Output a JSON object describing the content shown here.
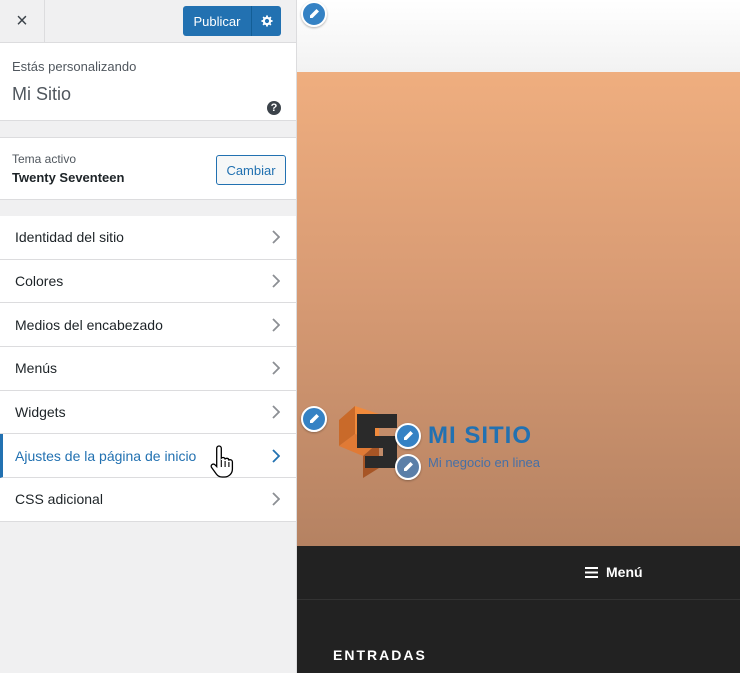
{
  "topbar": {
    "close_label": "×",
    "publish_label": "Publicar"
  },
  "customizing": {
    "label": "Estás personalizando",
    "site_name": "Mi Sitio",
    "help_label": "?"
  },
  "theme": {
    "label": "Tema activo",
    "name": "Twenty Seventeen",
    "change_label": "Cambiar"
  },
  "menu": {
    "items": [
      {
        "label": "Identidad del sitio"
      },
      {
        "label": "Colores"
      },
      {
        "label": "Medios del encabezado"
      },
      {
        "label": "Menús"
      },
      {
        "label": "Widgets"
      },
      {
        "label": "Ajustes de la página de inicio"
      },
      {
        "label": "CSS adicional"
      }
    ]
  },
  "preview": {
    "site_title": "MI SITIO",
    "site_tagline": "Mi negocio en linea",
    "menu_toggle": "Menú",
    "posts_heading": "ENTRADAS"
  },
  "colors": {
    "accent": "#2271b1",
    "hero_top": "#efae7f",
    "hero_bottom": "#b58262",
    "nav_bg": "#222222"
  },
  "icons": {
    "close": "close-icon",
    "settings": "gear-icon",
    "help": "help-icon",
    "chevron": "chevron-right-icon",
    "edit": "pencil-icon",
    "menu": "hamburger-icon",
    "cursor": "hand-pointer-icon"
  }
}
